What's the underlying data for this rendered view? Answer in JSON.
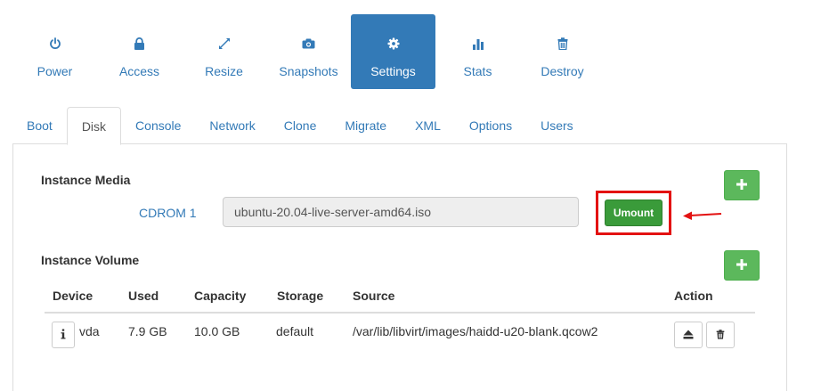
{
  "actions": [
    {
      "label": "Power",
      "icon": "power-icon"
    },
    {
      "label": "Access",
      "icon": "lock-icon"
    },
    {
      "label": "Resize",
      "icon": "resize-icon"
    },
    {
      "label": "Snapshots",
      "icon": "camera-icon"
    },
    {
      "label": "Settings",
      "icon": "gear-icon",
      "active": true
    },
    {
      "label": "Stats",
      "icon": "bar-chart-icon"
    },
    {
      "label": "Destroy",
      "icon": "trash-icon"
    }
  ],
  "tabs": [
    {
      "label": "Boot"
    },
    {
      "label": "Disk",
      "active": true
    },
    {
      "label": "Console"
    },
    {
      "label": "Network"
    },
    {
      "label": "Clone"
    },
    {
      "label": "Migrate"
    },
    {
      "label": "XML"
    },
    {
      "label": "Options"
    },
    {
      "label": "Users"
    }
  ],
  "media": {
    "title": "Instance Media",
    "cdrom_label": "CDROM 1",
    "cdrom_value": "ubuntu-20.04-live-server-amd64.iso",
    "umount_label": "Umount"
  },
  "volume": {
    "title": "Instance Volume",
    "columns": [
      "Device",
      "Used",
      "Capacity",
      "Storage",
      "Source",
      "Action"
    ],
    "rows": [
      {
        "device": "vda",
        "used": "7.9 GB",
        "capacity": "10.0 GB",
        "storage": "default",
        "source": "/var/lib/libvirt/images/haidd-u20-blank.qcow2"
      }
    ]
  },
  "colors": {
    "primary": "#337ab7",
    "success": "#5cb85c",
    "umount": "#3a9b3a",
    "annotation": "#e31212"
  }
}
